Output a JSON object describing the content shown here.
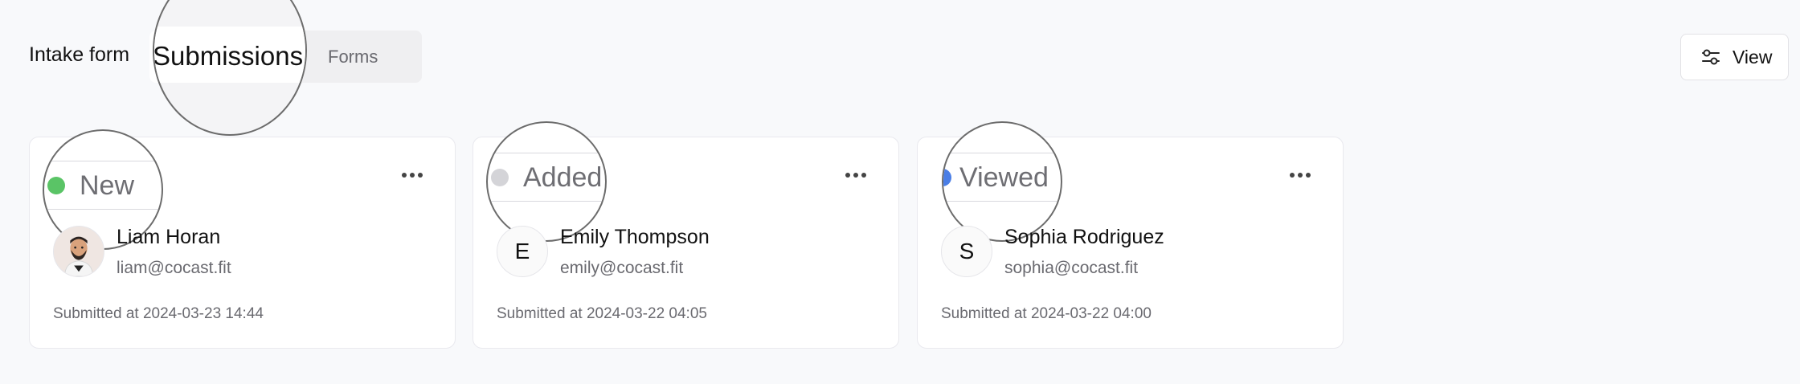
{
  "header": {
    "title": "Intake form",
    "tabs": [
      {
        "label": "Submissions",
        "active": true
      },
      {
        "label": "Forms",
        "active": false
      }
    ],
    "view_button": {
      "label": "View",
      "icon": "sliders-icon"
    }
  },
  "cards": [
    {
      "status": "New",
      "status_color": "#5ac466",
      "avatar_type": "photo",
      "avatar_initial": "",
      "name": "Liam Horan",
      "email": "liam@cocast.fit",
      "submitted": "Submitted at 2024-03-23 14:44"
    },
    {
      "status": "Added",
      "status_color": "#d4d4d8",
      "avatar_type": "initial",
      "avatar_initial": "E",
      "name": "Emily Thompson",
      "email": "emily@cocast.fit",
      "submitted": "Submitted at 2024-03-22 04:05"
    },
    {
      "status": "Viewed",
      "status_color": "#4a7ee6",
      "avatar_type": "initial",
      "avatar_initial": "S",
      "name": "Sophia Rodriguez",
      "email": "sophia@cocast.fit",
      "submitted": "Submitted at 2024-03-22 04:00"
    }
  ]
}
